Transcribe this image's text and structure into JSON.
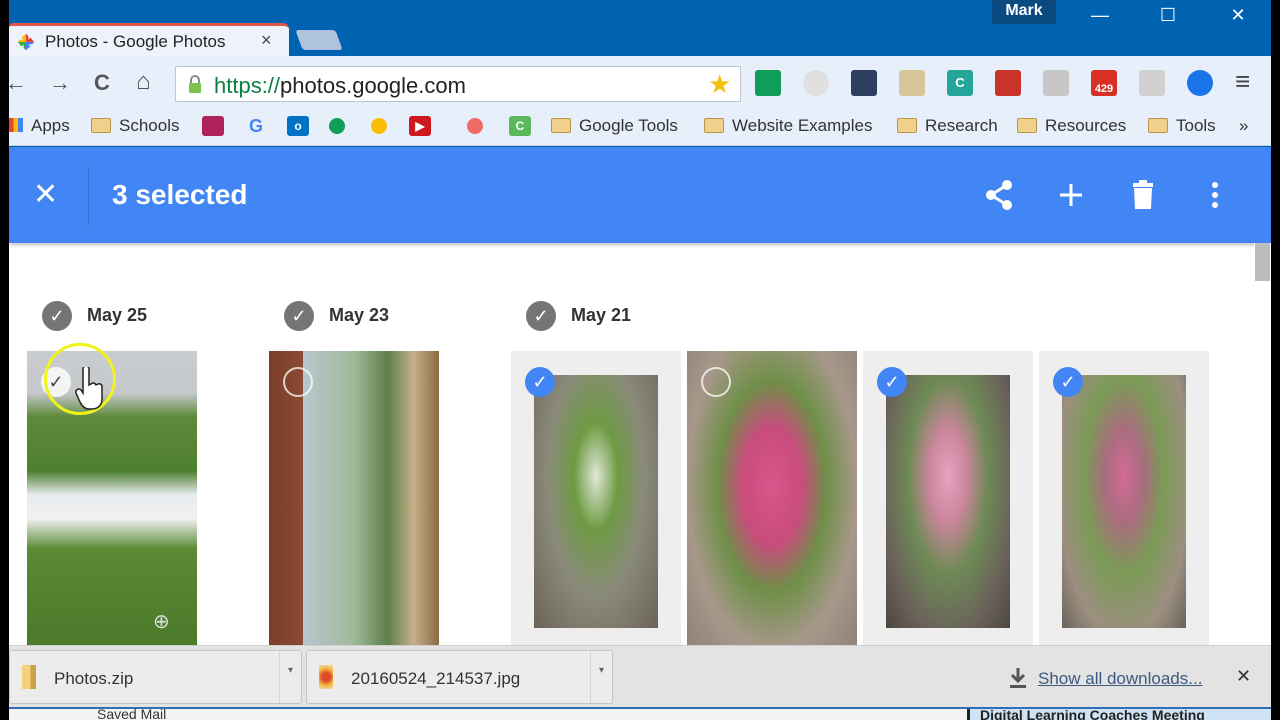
{
  "window": {
    "profile_name": "Mark",
    "controls": {
      "minimize": "—",
      "maximize": "☐",
      "close": "✕"
    }
  },
  "tab": {
    "title": "Photos - Google Photos",
    "close": "×",
    "favicon": "google-photos-pinwheel-icon"
  },
  "toolbar": {
    "back": "←",
    "forward": "→",
    "reload": "C",
    "home": "⌂",
    "url_scheme": "https://",
    "url_host": "photos.google.com",
    "bookmark_star": "★",
    "extensions": [
      {
        "name": "google-classroom-icon",
        "label": "",
        "color": "#0f9d58"
      },
      {
        "name": "chrome-webstore-icon",
        "label": "",
        "color": "#e0e0e0"
      },
      {
        "name": "screencastify-icon",
        "label": "",
        "color": "#2d3e5e"
      },
      {
        "name": "color-palette-icon",
        "label": "",
        "color": "#d8c59a"
      },
      {
        "name": "c-extension-icon",
        "label": "C",
        "color": "#26a69a"
      },
      {
        "name": "red-book-icon",
        "label": "",
        "color": "#c9342a"
      },
      {
        "name": "chat-bubble-icon",
        "label": "",
        "color": "#c7c7c7"
      },
      {
        "name": "gmail-checker-icon",
        "label": "429",
        "color": "#d93025"
      },
      {
        "name": "grid-apps-icon",
        "label": "",
        "color": "#d0d0d0"
      },
      {
        "name": "water-bottle-icon",
        "label": "",
        "color": "#1a73e8"
      }
    ],
    "menu": "≡"
  },
  "bookmarks": {
    "apps_label": "Apps",
    "items": [
      {
        "type": "folder",
        "label": "Schools"
      },
      {
        "type": "icon",
        "name": "classroom-bookmark-icon",
        "color": "#b0225a"
      },
      {
        "type": "icon",
        "name": "google-bookmark-icon",
        "label": "G",
        "color": "#4285f4"
      },
      {
        "type": "icon",
        "name": "outlook-bookmark-icon",
        "label": "o",
        "color": "#0072c6"
      },
      {
        "type": "icon",
        "name": "google-drive-bookmark-icon",
        "color": "#0f9d58"
      },
      {
        "type": "icon",
        "name": "google-photos-bookmark-icon",
        "color": "#fbbc05"
      },
      {
        "type": "icon",
        "name": "youtube-bookmark-icon",
        "label": "▶",
        "color": "#cc181e"
      },
      {
        "type": "icon",
        "name": "asana-bookmark-icon",
        "color": "#f06a6a"
      },
      {
        "type": "icon",
        "name": "c-bookmark-icon",
        "label": "C",
        "color": "#5cb85c"
      },
      {
        "type": "folder",
        "label": "Google Tools"
      },
      {
        "type": "folder",
        "label": "Website Examples"
      },
      {
        "type": "folder",
        "label": "Research"
      },
      {
        "type": "folder",
        "label": "Resources"
      },
      {
        "type": "folder",
        "label": "Tools"
      }
    ],
    "overflow": "»"
  },
  "selection_bar": {
    "close": "✕",
    "title": "3 selected",
    "actions": [
      "share",
      "add",
      "delete",
      "more"
    ]
  },
  "groups": [
    {
      "date": "May 25",
      "check": "✓"
    },
    {
      "date": "May 23",
      "check": "✓"
    },
    {
      "date": "May 21",
      "check": "✓"
    }
  ],
  "photos": [
    {
      "group": "May 25",
      "selected": false,
      "state": "hover",
      "subject": "snow patch on grass"
    },
    {
      "group": "May 23",
      "selected": false,
      "state": "unselected",
      "subject": "window view with boxes"
    },
    {
      "group": "May 21",
      "selected": true,
      "state": "selected",
      "subject": "white-flowered shrub"
    },
    {
      "group": "May 21",
      "selected": false,
      "state": "unselected",
      "subject": "pink-flowered shrub"
    },
    {
      "group": "May 21",
      "selected": true,
      "state": "selected",
      "subject": "pink-flowered shrub"
    },
    {
      "group": "May 21",
      "selected": true,
      "state": "selected",
      "subject": "pink-flowered shrub"
    }
  ],
  "check_glyph": "✓",
  "zoom_glyph": "⊕",
  "downloads": {
    "items": [
      {
        "name": "Photos.zip",
        "icon": "zip-file-icon"
      },
      {
        "name": "20160524_214537.jpg",
        "icon": "image-file-icon"
      }
    ],
    "dropdown": "▾",
    "show_all": "Show all downloads...",
    "close": "✕"
  },
  "background_window": {
    "left_text": "Saved Mail",
    "right_text": "Digital Learning Coaches Meeting"
  }
}
